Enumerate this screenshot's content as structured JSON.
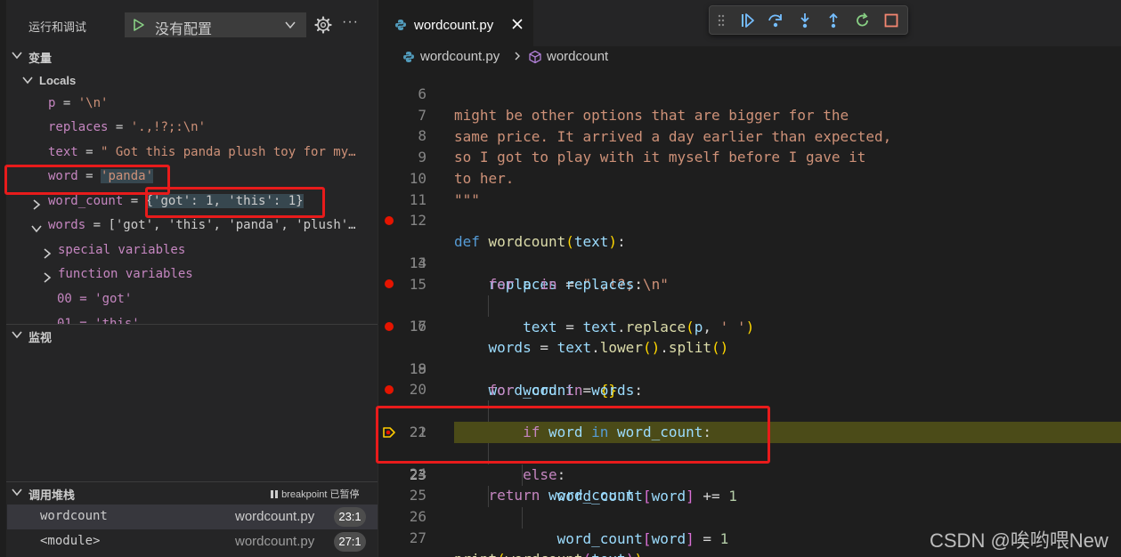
{
  "colors": {
    "accent_red": "#e81b1b",
    "breakpoint": "#e51400",
    "current_line": "#4b4b18",
    "sidebar_bg": "#252526",
    "editor_bg": "#1e1e1e"
  },
  "debug": {
    "title": "运行和调试",
    "config_value": "没有配置",
    "icons": {
      "play": "play-icon",
      "chevron": "chevron-down-icon",
      "gear": "gear-icon",
      "more": "more-icon"
    },
    "more_glyph": "···"
  },
  "variables": {
    "section_label": "变量",
    "locals_label": "Locals",
    "rows": [
      {
        "name": "p",
        "sep": " = ",
        "value": "'\\n'"
      },
      {
        "name": "replaces",
        "sep": " = ",
        "value": "'.,!?;:\\n'"
      },
      {
        "name": "text",
        "sep": " = ",
        "value": "\" Got this panda plush toy for my…"
      },
      {
        "name": "word",
        "sep": " = ",
        "value": "'panda'"
      },
      {
        "name": "word_count",
        "sep": " = ",
        "value": "{'got': 1, 'this': 1}"
      },
      {
        "name": "words",
        "sep": " = ",
        "value": "['got', 'this', 'panda', 'plush'…"
      }
    ],
    "special_label": "special variables",
    "function_label": "function variables",
    "item_00": "00 = 'got'",
    "item_01": "01 = 'this'"
  },
  "watch": {
    "section_label": "监视"
  },
  "callstack": {
    "section_label": "调用堆栈",
    "status": "breakpoint 已暂停",
    "frames": [
      {
        "fn": "wordcount",
        "file": "wordcount.py",
        "pos": "23:1"
      },
      {
        "fn": "<module>",
        "file": "wordcount.py",
        "pos": "27:1"
      }
    ]
  },
  "editor": {
    "tab_label": "wordcount.py",
    "breadcrumb_file": "wordcount.py",
    "breadcrumb_symbol": "wordcount",
    "line_numbers": [
      "6",
      "7",
      "8",
      "9",
      "10",
      "11",
      "12",
      "13",
      "14",
      "15",
      "16",
      "17",
      "18",
      "19",
      "20",
      "21",
      "22",
      "23",
      "24",
      "25",
      "26",
      "27"
    ]
  },
  "watermark": "CSDN @唉哟喂New"
}
